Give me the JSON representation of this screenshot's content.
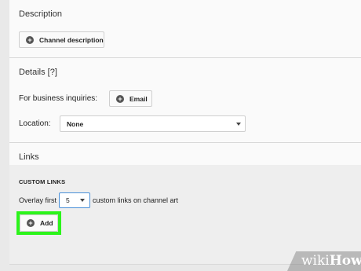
{
  "description": {
    "title": "Description",
    "channel_description_button": "Channel description"
  },
  "details": {
    "title": "Details [?]",
    "business_label": "For business inquiries:",
    "email_button": "Email",
    "location_label": "Location:",
    "location_value": "None"
  },
  "links": {
    "title": "Links",
    "custom_links_heading": "CUSTOM LINKS",
    "overlay_prefix": "Overlay first",
    "overlay_count": "5",
    "overlay_suffix": "custom links on channel art",
    "add_button": "Add"
  },
  "icons": {
    "plus": "+"
  },
  "watermark": {
    "part1": "wiki",
    "part2": "How"
  },
  "colors": {
    "highlight": "#2cf41b",
    "select_focus_border": "#4a90d9"
  }
}
